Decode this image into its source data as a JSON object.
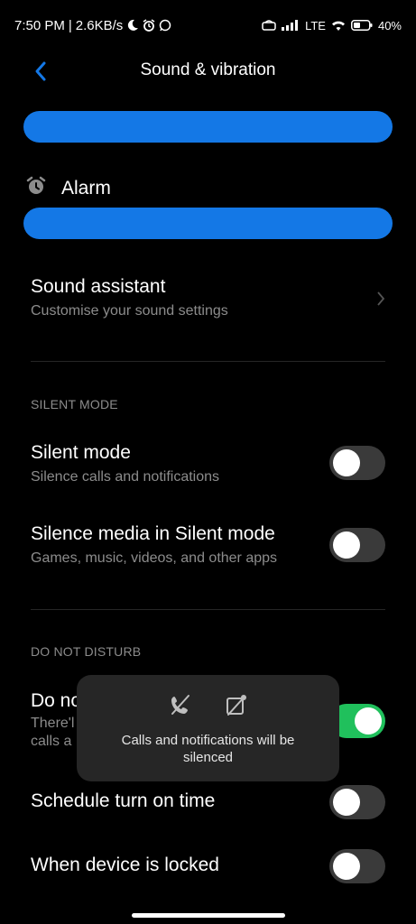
{
  "status_bar": {
    "time": "7:50 PM",
    "separator": "|",
    "speed": "2.6KB/s",
    "network": "LTE",
    "battery": "40%"
  },
  "header": {
    "title": "Sound & vibration"
  },
  "volume": {
    "alarm_label": "Alarm"
  },
  "sound_assistant": {
    "title": "Sound assistant",
    "subtitle": "Customise your sound settings"
  },
  "silent_section": {
    "heading": "SILENT MODE",
    "silent_mode": {
      "title": "Silent mode",
      "subtitle": "Silence calls and notifications",
      "enabled": false
    },
    "silence_media": {
      "title": "Silence media in Silent mode",
      "subtitle": "Games, music, videos, and other apps",
      "enabled": false
    }
  },
  "dnd_section": {
    "heading": "DO NOT DISTURB",
    "dnd": {
      "title_partial": "Do no",
      "subtitle_partial_1": "There'l",
      "subtitle_partial_2": "calls a",
      "enabled": true
    },
    "schedule": {
      "title": "Schedule turn on time",
      "enabled": false
    },
    "when_locked": {
      "title": "When device is locked",
      "enabled": false
    }
  },
  "toast": {
    "message": "Calls and notifications will be silenced"
  },
  "colors": {
    "accent": "#1478e6",
    "toggle_on": "#20c05c",
    "toggle_off": "#3a3a3a",
    "back_arrow": "#1478e6"
  }
}
